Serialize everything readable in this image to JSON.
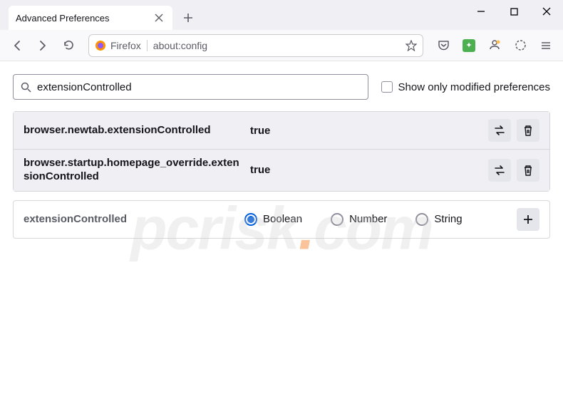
{
  "window": {
    "tab_title": "Advanced Preferences"
  },
  "urlbar": {
    "identity_label": "Firefox",
    "url": "about:config"
  },
  "search": {
    "value": "extensionControlled",
    "modified_only_label": "Show only modified preferences"
  },
  "prefs": [
    {
      "name": "browser.newtab.extensionControlled",
      "value": "true"
    },
    {
      "name": "browser.startup.homepage_override.extensionControlled",
      "value": "true"
    }
  ],
  "new_pref": {
    "name": "extensionControlled",
    "types": [
      "Boolean",
      "Number",
      "String"
    ],
    "selected": "Boolean"
  },
  "watermark": {
    "prefix": "pcrisk",
    "dot": ".",
    "suffix": "com"
  }
}
